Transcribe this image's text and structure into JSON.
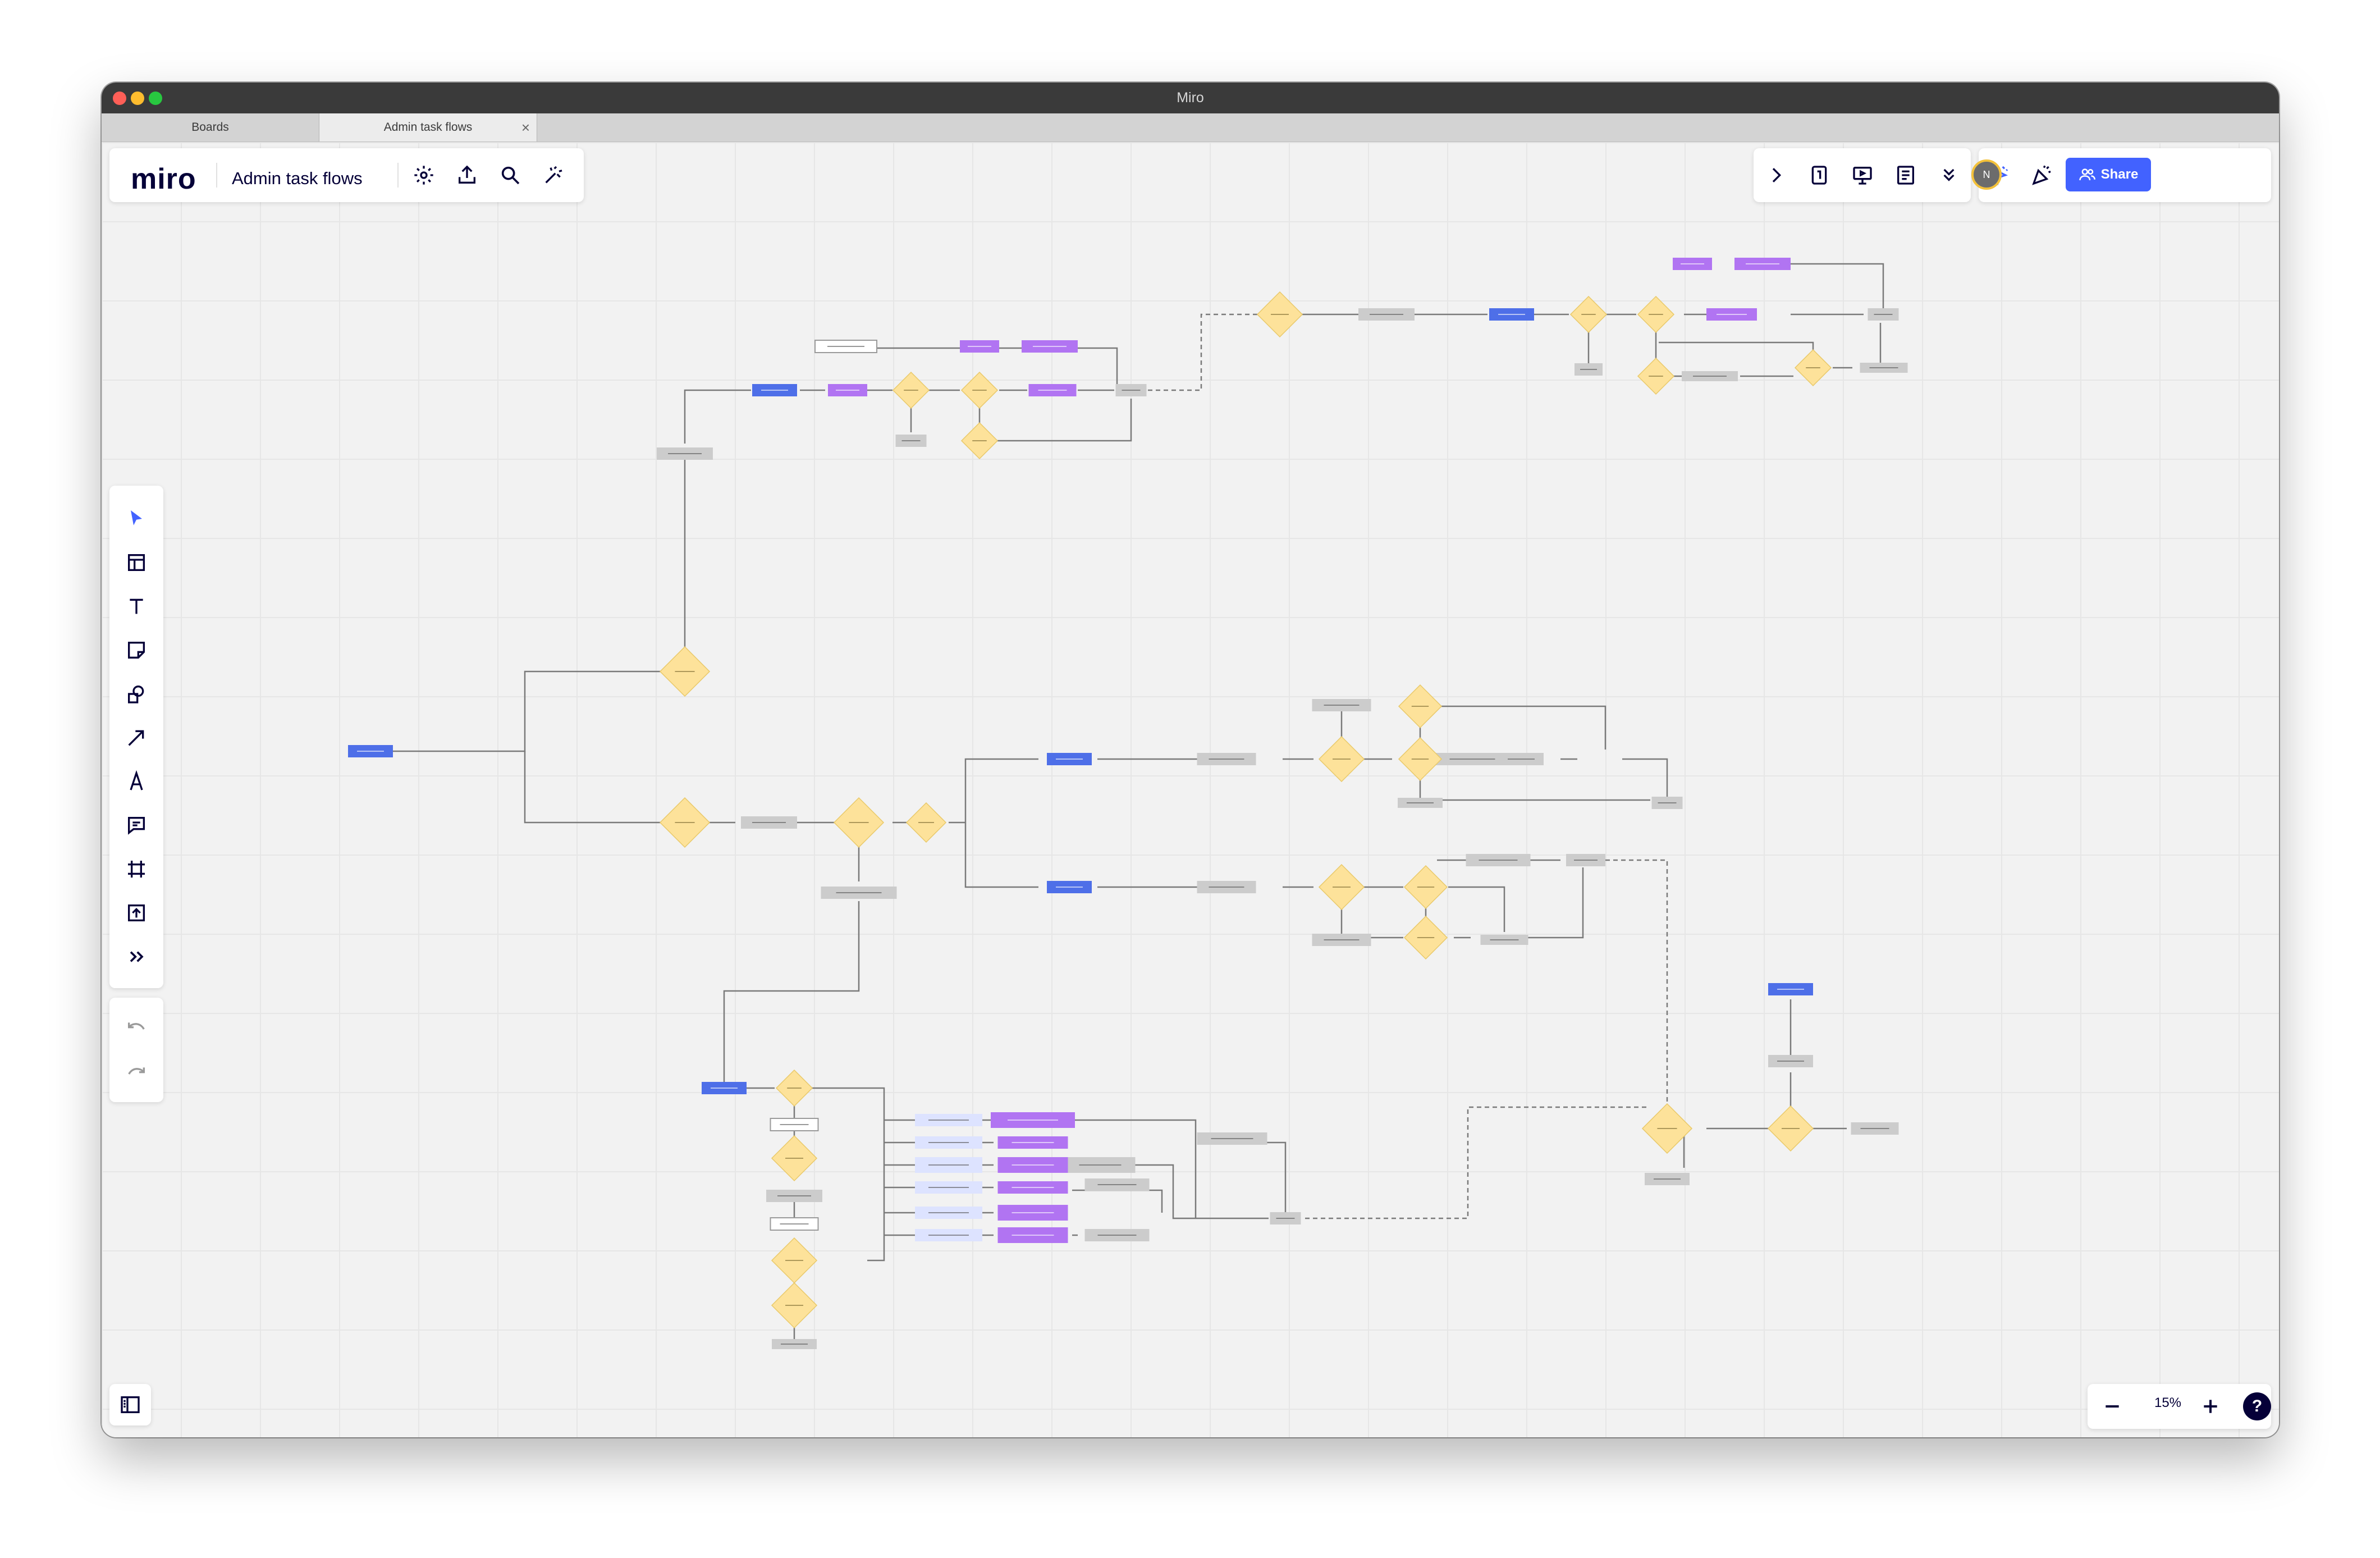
{
  "window": {
    "title": "Miro"
  },
  "tabs": [
    {
      "label": "Boards"
    },
    {
      "label": "Admin task flows"
    }
  ],
  "header": {
    "logo": "miro",
    "board_name": "Admin task flows"
  },
  "top_left_icons": [
    "settings-icon",
    "export-icon",
    "search-icon",
    "magic-wand-icon"
  ],
  "top_center_icons": [
    "chevron-right-icon",
    "timer-icon",
    "present-icon",
    "notes-icon",
    "more-chevrons-icon"
  ],
  "top_right": {
    "icons": [
      "reactions-cursor-icon",
      "celebrate-icon",
      "bell-icon"
    ],
    "avatar_initial": "N",
    "share_label": "Share"
  },
  "left_toolbar": [
    "select-tool",
    "templates-tool",
    "text-tool",
    "sticky-note-tool",
    "shapes-tool",
    "connector-tool",
    "pen-tool",
    "comment-tool",
    "frame-tool",
    "upload-tool",
    "more-tools"
  ],
  "history": [
    "undo",
    "redo"
  ],
  "zoom": {
    "value": "15%"
  },
  "colors": {
    "accent": "#4262ff",
    "blue_node": "#4e6fe8",
    "purple_node": "#b174f2",
    "diamond": "#fde29a",
    "grey_node": "#cccccc",
    "lavender_node": "#dde3ff"
  }
}
